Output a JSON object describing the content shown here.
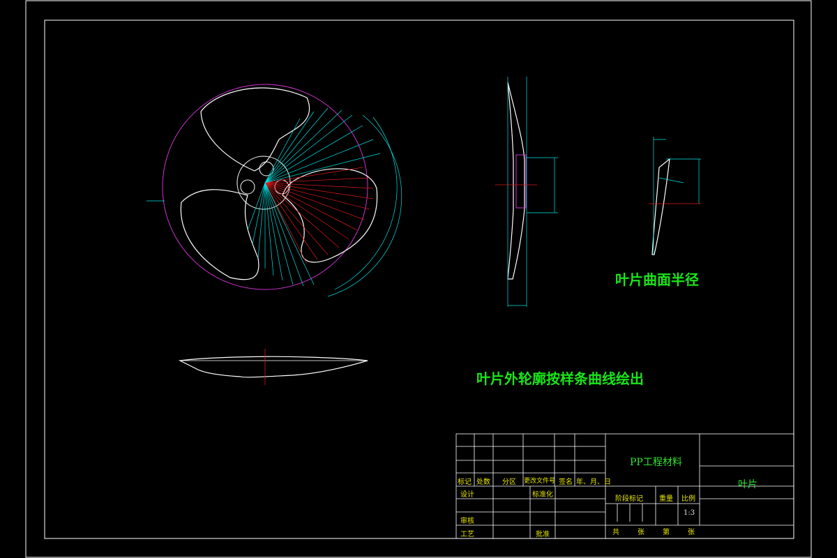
{
  "notes": {
    "blade_surface_radius": "叶片曲面半径",
    "blade_outline_spline": "叶片外轮廓按样条曲线绘出"
  },
  "title_block": {
    "material": "PP工程材料",
    "part_name": "叶片",
    "scale_value": "1:3",
    "headers": {
      "mark": "标记",
      "count": "处数",
      "zone": "分区",
      "change_doc_no": "更改文件号",
      "signature": "签名",
      "date": "年、月、日",
      "design": "设计",
      "standardization": "标准化",
      "stage_mark": "阶段标记",
      "weight": "重量",
      "scale": "比例",
      "review": "审核",
      "process": "工艺",
      "approve": "批准",
      "total": "共",
      "sheets": "张",
      "page": "第",
      "sheet_suffix": "张"
    }
  },
  "colors": {
    "frame": "#ffffff",
    "blade": "#ffffff",
    "circle": "#cc33cc",
    "dimension": "#00e5e5",
    "section_lines": "#e01a1a",
    "note_text": "#19e619",
    "title_text": "#e6e600"
  }
}
